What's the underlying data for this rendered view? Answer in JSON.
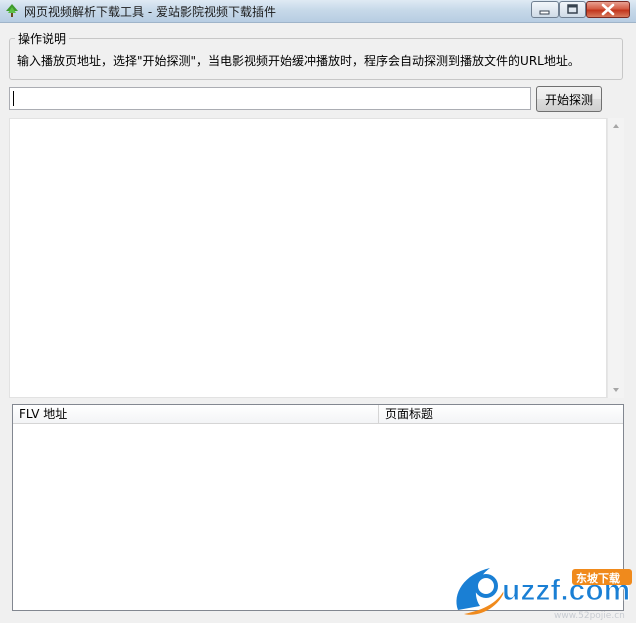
{
  "window": {
    "title": "网页视频解析下载工具 - 爱站影院视频下载插件",
    "app_icon": "green-tree-icon",
    "controls": {
      "minimize": "minimize-icon",
      "maximize": "maximize-icon",
      "close": "close-icon"
    }
  },
  "instructions": {
    "legend": "操作说明",
    "text": "输入播放页地址，选择\"开始探测\"，当电影视频开始缓冲播放时，程序会自动探测到播放文件的URL地址。"
  },
  "url_input": {
    "value": "",
    "placeholder": ""
  },
  "detect_button": {
    "label": "开始探测"
  },
  "log_area": {
    "content": ""
  },
  "list": {
    "columns": [
      {
        "label": "FLV 地址"
      },
      {
        "label": "页面标题"
      }
    ],
    "rows": []
  },
  "watermark": {
    "brand": "uzzf.com",
    "tag": "东坡下载",
    "url": "www.52pojie.cn"
  },
  "colors": {
    "title_bar": "#c7d9e9",
    "close_button": "#c2351c",
    "window_bg": "#f0f0f0",
    "watermark_blue": "#1a7fd4",
    "watermark_orange": "#f08a1c"
  }
}
